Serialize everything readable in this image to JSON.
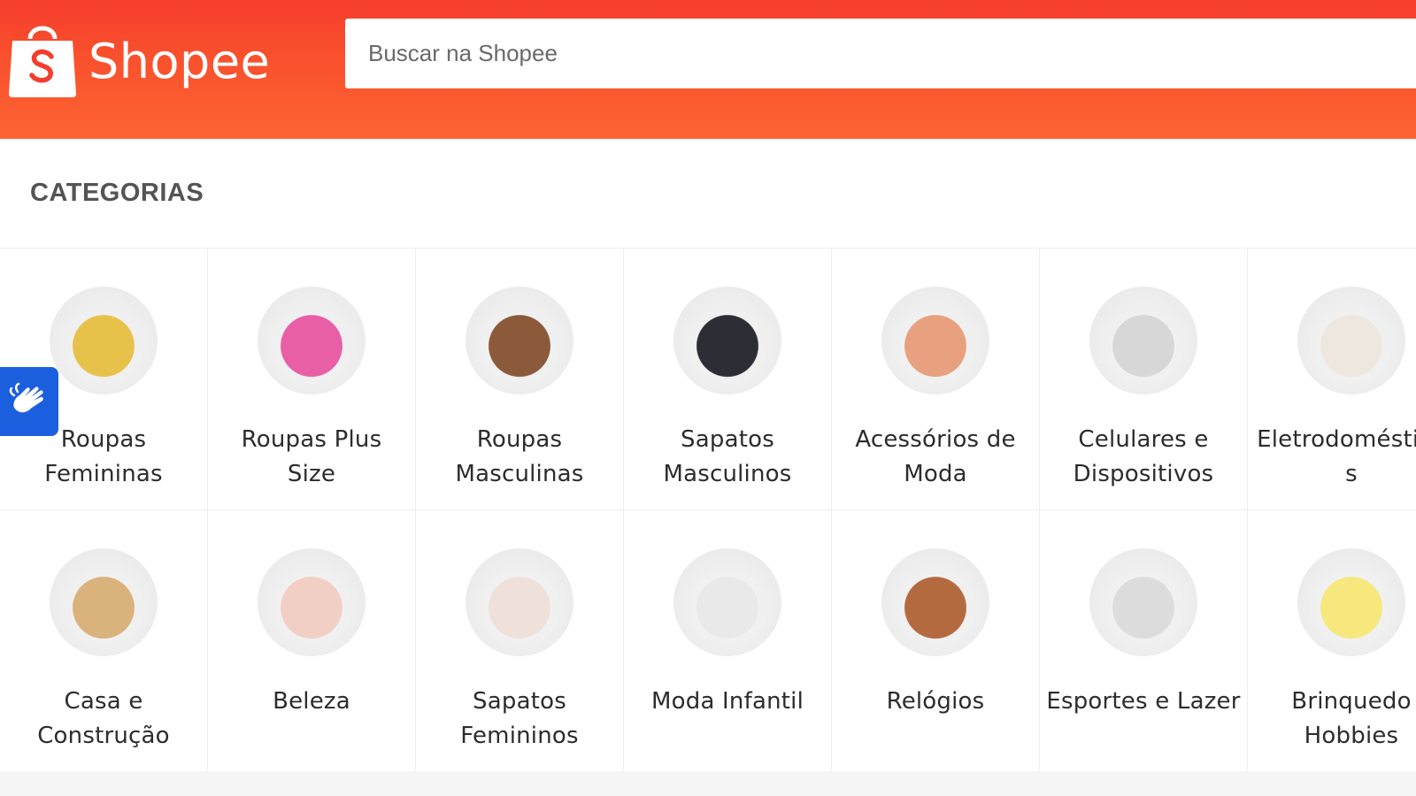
{
  "header": {
    "logo_text": "Shopee",
    "search_placeholder": "Buscar na Shopee"
  },
  "categories": {
    "title": "CATEGORIAS",
    "items": [
      {
        "label": "Roupas Femininas",
        "icon": "women-clothes-icon",
        "color": "#e7c24a"
      },
      {
        "label": "Roupas Plus Size",
        "icon": "plus-size-clothes-icon",
        "color": "#e85fa6"
      },
      {
        "label": "Roupas Masculinas",
        "icon": "men-clothes-icon",
        "color": "#8b5a3a"
      },
      {
        "label": "Sapatos Masculinos",
        "icon": "men-shoes-icon",
        "color": "#2d2d35"
      },
      {
        "label": "Acessórios de Moda",
        "icon": "sunglasses-icon",
        "color": "#e8a07e"
      },
      {
        "label": "Celulares e Dispositivos",
        "icon": "phone-icon",
        "color": "#d7d7d7"
      },
      {
        "label": "Eletrodoméstico s",
        "icon": "air-fryer-icon",
        "color": "#ede7df"
      },
      {
        "label": "Casa e Construção",
        "icon": "toolbox-icon",
        "color": "#d9b27c"
      },
      {
        "label": "Beleza",
        "icon": "cosmetics-icon",
        "color": "#f1cfc4"
      },
      {
        "label": "Sapatos Femininos",
        "icon": "women-shoes-icon",
        "color": "#efe1d9"
      },
      {
        "label": "Moda Infantil",
        "icon": "kids-fashion-icon",
        "color": "#e9e9e9"
      },
      {
        "label": "Relógios",
        "icon": "watch-icon",
        "color": "#b46a3f"
      },
      {
        "label": "Esportes e Lazer",
        "icon": "bicycle-icon",
        "color": "#dcdcdc"
      },
      {
        "label": "Brinquedo Hobbies",
        "icon": "doll-icon",
        "color": "#f6e87d"
      }
    ]
  },
  "accessibility_button": {
    "icon": "sign-language-icon",
    "color": "#1c5fde"
  },
  "colors": {
    "brand": "#f53d2d",
    "brand_end": "#fe6433"
  }
}
